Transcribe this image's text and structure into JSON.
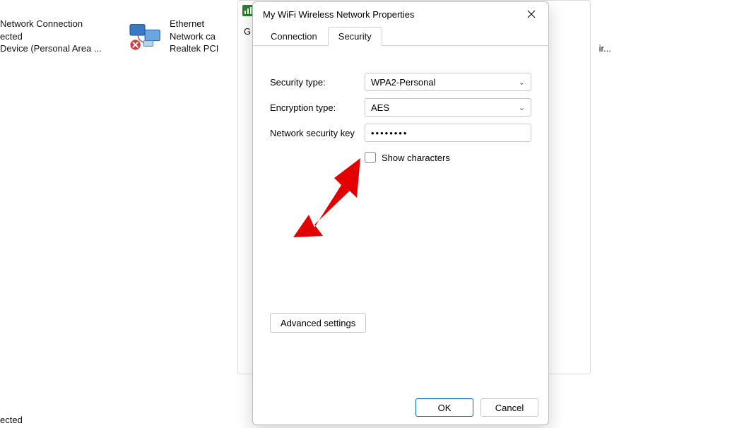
{
  "background": {
    "item_left": {
      "l1": " Network Connection",
      "l2": "ected",
      "l3": " Device (Personal Area ..."
    },
    "item_mid": {
      "l1": "Ethernet",
      "l2": "Network ca",
      "l3": "Realtek PCI"
    },
    "behind_char1": "G",
    "behind_char2": "ir...",
    "bottom": "ected"
  },
  "dialog": {
    "title": "My WiFi Wireless Network Properties",
    "tabs": {
      "connection": "Connection",
      "security": "Security"
    },
    "labels": {
      "security_type": "Security type:",
      "encryption_type": "Encryption type:",
      "network_key": "Network security key",
      "show_characters": "Show characters"
    },
    "values": {
      "security_type": "WPA2-Personal",
      "encryption_type": "AES",
      "password_mask": "••••••••"
    },
    "buttons": {
      "advanced": "Advanced settings",
      "ok": "OK",
      "cancel": "Cancel"
    }
  }
}
